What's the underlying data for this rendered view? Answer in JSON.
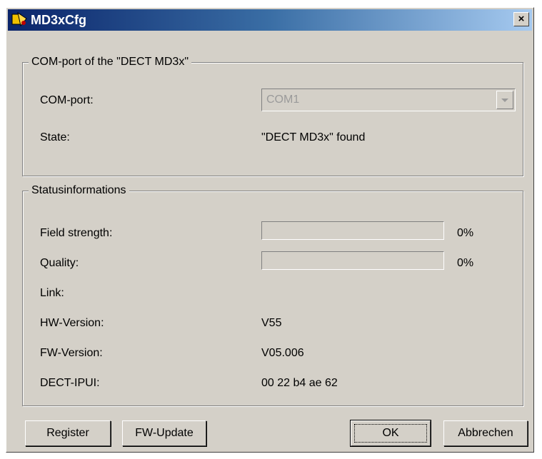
{
  "window": {
    "title": "MD3xCfg",
    "close_label": "×"
  },
  "com_group": {
    "legend": "COM-port of the \"DECT MD3x\"",
    "com_port_label": "COM-port:",
    "com_port_value": "COM1",
    "state_label": "State:",
    "state_value": "\"DECT MD3x\" found"
  },
  "status_group": {
    "legend": "Statusinformations",
    "field_strength_label": "Field strength:",
    "field_strength_value": "0%",
    "field_strength_level": 0,
    "quality_label": "Quality:",
    "quality_value": "0%",
    "quality_level": 0,
    "link_label": "Link:",
    "hw_label": "HW-Version:",
    "hw_value": "V55",
    "fw_label": "FW-Version:",
    "fw_value": "V05.006",
    "ipui_label": "DECT-IPUI:",
    "ipui_value": "00 22 b4 ae 62"
  },
  "buttons": {
    "register": "Register",
    "fw_update": "FW-Update",
    "ok": "OK",
    "cancel": "Abbrechen"
  },
  "colors": {
    "title_gradient_start": "#0a246a",
    "dialog_face": "#d4d0c8"
  },
  "icons": {
    "app": "app-icon",
    "close": "close-icon",
    "dropdown": "chevron-down-icon"
  }
}
